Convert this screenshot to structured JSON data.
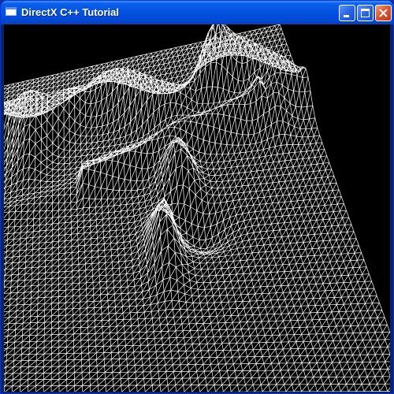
{
  "window": {
    "title": "DirectX C++ Tutorial",
    "title_color": "#FFFFFF",
    "titlebar_color": "#0A5FEA",
    "buttons": {
      "minimize": "minimize-icon",
      "maximize": "maximize-icon",
      "close": "close-icon"
    }
  },
  "scene": {
    "background_color": "#000000",
    "wire_color": "#FFFFFF",
    "render_mode": "wireframe"
  }
}
